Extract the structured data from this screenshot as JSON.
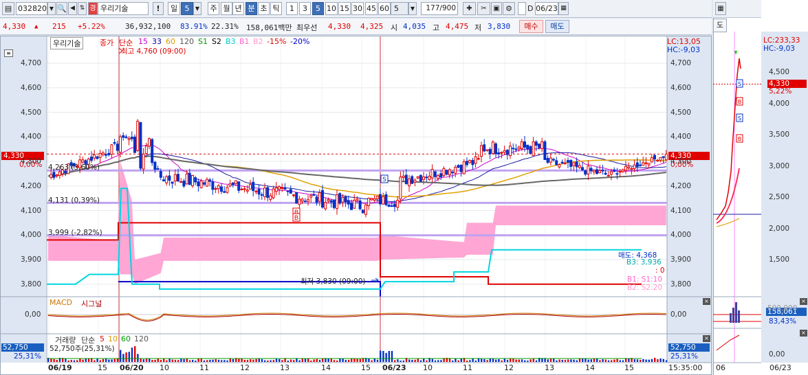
{
  "toolbar": {
    "code": "032820",
    "name": "우리기술",
    "period_label": "일",
    "period_value": "5",
    "periods": [
      "주",
      "월",
      "년",
      "분",
      "초",
      "틱"
    ],
    "minutes": [
      "1",
      "3",
      "5",
      "10",
      "15",
      "30",
      "45",
      "60"
    ],
    "count_value": "5",
    "range_text": "177/900",
    "date_value": "06/23",
    "checkbox_label": "D",
    "badge": "경"
  },
  "quote": {
    "price": "4,330",
    "arrow": "▲",
    "change": "215",
    "change_pct": "+5.22%",
    "volume": "36,932,100",
    "ratio1": "83.91%",
    "ratio2": "22.31%",
    "amount": "158,061백만",
    "best_label": "최우선",
    "ask": "4,330",
    "bid": "4,325",
    "open_label": "시",
    "open": "4,035",
    "high_label": "고",
    "high": "4,475",
    "low_label": "저",
    "low": "3,830",
    "buy_label": "매수",
    "sell_label": "매도"
  },
  "price_panel": {
    "title": "우리기술",
    "legend": [
      {
        "t": "종가",
        "c": "#e00000"
      },
      {
        "t": "단순",
        "c": "#e00000"
      },
      {
        "t": "15",
        "c": "#cc00cc"
      },
      {
        "t": "33",
        "c": "#0000aa"
      },
      {
        "t": "60",
        "c": "#d89a00"
      },
      {
        "t": "120",
        "c": "#555555"
      },
      {
        "t": "S1",
        "c": "#009900"
      },
      {
        "t": "S2",
        "c": "#000000"
      },
      {
        "t": "B3",
        "c": "#00cccc"
      },
      {
        "t": "B1",
        "c": "#ff66cc"
      },
      {
        "t": "B2",
        "c": "#ff99cc"
      },
      {
        "t": "-15%",
        "c": "#e00000"
      },
      {
        "t": "-20%",
        "c": "#0000cc"
      }
    ],
    "lc": "LC:13,05",
    "hc": "HC:-9,03",
    "high_annot": "최고 4,760 (09:00)",
    "low_annot": "최저 3,830 (09:00)",
    "line1": "4,263 (3,60%)",
    "line2": "4,131 (0,39%)",
    "line3": "3,999 (-2,82%)",
    "cur_price": "4,330",
    "cur_pct": "0,00%",
    "sell_tag": "매도: 4,368",
    "b3_tag": "B3: 3,936",
    "zero_tag": ": 0",
    "b1_tag": "B1: S1:10",
    "b2_tag": "B2: S2:20",
    "y_ticks": [
      "4,700",
      "4,600",
      "4,500",
      "4,400",
      "4,300",
      "4,200",
      "4,100",
      "4,000",
      "3,900",
      "3,800"
    ]
  },
  "macd_panel": {
    "labels": [
      "MACD",
      "시그널"
    ],
    "y_tick": "0,00"
  },
  "volume_panel": {
    "labels": [
      "거래량",
      "단순",
      "5",
      "10",
      "60",
      "120"
    ],
    "volume_text": "52,750주(25,31%)",
    "left_val": "52,750",
    "left_pct": "25,31%",
    "right_val": "52,750",
    "right_pct": "25,31%"
  },
  "x_axis": [
    "06/19",
    "15",
    "06/20",
    "10",
    "11",
    "12",
    "13",
    "14",
    "15",
    "06/23",
    "10",
    "11",
    "12",
    "13",
    "14",
    "15"
  ],
  "x_time": "15:35:00",
  "side_chart": {
    "lc": "LC:233,33",
    "hc": "HC:-9,03",
    "price": "4,330",
    "pct": "5,22%",
    "y_ticks": [
      "4,500",
      "4,000",
      "3,500",
      "3,000",
      "2,500",
      "2,000",
      "1,500"
    ],
    "macd_val": "158,061",
    "macd_pct": "83,43%",
    "macd_tick": "500,000",
    "vol_tick": "0,00",
    "x_left": "06",
    "x_right": "06/23",
    "tab": "도"
  }
}
